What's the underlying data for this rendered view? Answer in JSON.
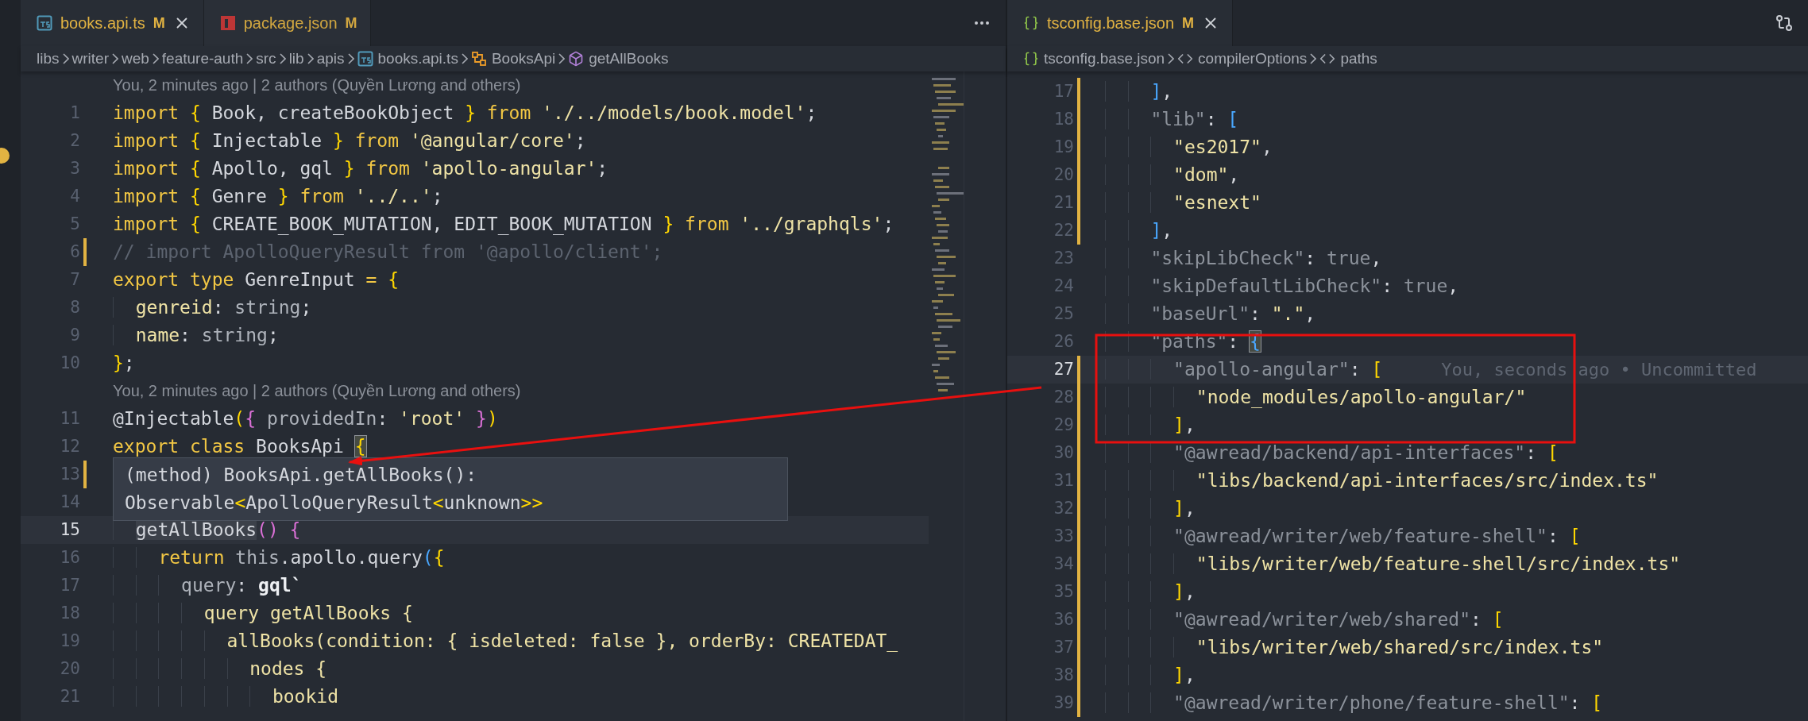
{
  "left_editor": {
    "tabs": [
      {
        "label": "books.api.ts",
        "status": "M",
        "kind": "ts",
        "selected": true
      },
      {
        "label": "package.json",
        "status": "M",
        "kind": "npm",
        "selected": false
      }
    ],
    "breadcrumbs": [
      {
        "kind": "folder",
        "text": "libs"
      },
      {
        "kind": "folder",
        "text": "writer"
      },
      {
        "kind": "folder",
        "text": "web"
      },
      {
        "kind": "folder",
        "text": "feature-auth"
      },
      {
        "kind": "folder",
        "text": "src"
      },
      {
        "kind": "folder",
        "text": "lib"
      },
      {
        "kind": "folder",
        "text": "apis"
      },
      {
        "kind": "ts",
        "text": "books.api.ts"
      },
      {
        "kind": "class",
        "text": "BooksApi"
      },
      {
        "kind": "method",
        "text": "getAllBooks"
      }
    ],
    "lines": [
      {
        "kind": "blame",
        "text": "You, 2 minutes ago | 2 authors (Quyền Lương and others)"
      },
      {
        "kind": "code",
        "number": "1",
        "modified": false,
        "current": false,
        "tokens": [
          {
            "kind": "kw",
            "text": "import"
          },
          {
            "kind": "b1",
            "text": " {"
          },
          {
            "kind": "id",
            "text": " Book, createBookObject "
          },
          {
            "kind": "b1",
            "text": "}"
          },
          {
            "kind": "kw",
            "text": " from"
          },
          {
            "kind": "str",
            "text": " './../models/book.model'"
          },
          {
            "kind": "id",
            "text": ";"
          }
        ]
      },
      {
        "kind": "code",
        "number": "2",
        "modified": false,
        "current": false,
        "tokens": [
          {
            "kind": "kw",
            "text": "import"
          },
          {
            "kind": "b1",
            "text": " {"
          },
          {
            "kind": "id",
            "text": " Injectable "
          },
          {
            "kind": "b1",
            "text": "}"
          },
          {
            "kind": "kw",
            "text": " from"
          },
          {
            "kind": "str",
            "text": " '@angular/core'"
          },
          {
            "kind": "id",
            "text": ";"
          }
        ]
      },
      {
        "kind": "code",
        "number": "3",
        "modified": false,
        "current": false,
        "tokens": [
          {
            "kind": "kw",
            "text": "import"
          },
          {
            "kind": "b1",
            "text": " {"
          },
          {
            "kind": "id",
            "text": " Apollo, gql "
          },
          {
            "kind": "b1",
            "text": "}"
          },
          {
            "kind": "kw",
            "text": " from"
          },
          {
            "kind": "str",
            "text": " 'apollo-angular'"
          },
          {
            "kind": "id",
            "text": ";"
          }
        ]
      },
      {
        "kind": "code",
        "number": "4",
        "modified": false,
        "current": false,
        "tokens": [
          {
            "kind": "kw",
            "text": "import"
          },
          {
            "kind": "b1",
            "text": " {"
          },
          {
            "kind": "id",
            "text": " Genre "
          },
          {
            "kind": "b1",
            "text": "}"
          },
          {
            "kind": "kw",
            "text": " from"
          },
          {
            "kind": "str",
            "text": " '../..'"
          },
          {
            "kind": "id",
            "text": ";"
          }
        ]
      },
      {
        "kind": "code",
        "number": "5",
        "modified": false,
        "current": false,
        "tokens": [
          {
            "kind": "kw",
            "text": "import"
          },
          {
            "kind": "b1",
            "text": " {"
          },
          {
            "kind": "id",
            "text": " CREATE_BOOK_MUTATION, EDIT_BOOK_MUTATION "
          },
          {
            "kind": "b1",
            "text": "}"
          },
          {
            "kind": "kw",
            "text": " from"
          },
          {
            "kind": "str",
            "text": " '../graphqls'"
          },
          {
            "kind": "id",
            "text": ";"
          }
        ]
      },
      {
        "kind": "code",
        "number": "6",
        "modified": true,
        "current": false,
        "tokens": [
          {
            "kind": "cmt",
            "text": "// import ApolloQueryResult from '@apollo/client';"
          }
        ]
      },
      {
        "kind": "code",
        "number": "7",
        "modified": false,
        "current": false,
        "tokens": [
          {
            "kind": "kw",
            "text": "export"
          },
          {
            "kind": "kw",
            "text": " type"
          },
          {
            "kind": "id",
            "text": " GenreInput "
          },
          {
            "kind": "kw",
            "text": "="
          },
          {
            "kind": "b1",
            "text": " {"
          }
        ]
      },
      {
        "kind": "code",
        "number": "8",
        "modified": false,
        "current": false,
        "tokens": [
          {
            "kind": "prop",
            "text": "  genreid"
          },
          {
            "kind": "id",
            "text": ": "
          },
          {
            "kind": "type",
            "text": "string"
          },
          {
            "kind": "id",
            "text": ";"
          }
        ]
      },
      {
        "kind": "code",
        "number": "9",
        "modified": false,
        "current": false,
        "tokens": [
          {
            "kind": "prop",
            "text": "  name"
          },
          {
            "kind": "id",
            "text": ": "
          },
          {
            "kind": "type",
            "text": "string"
          },
          {
            "kind": "id",
            "text": ";"
          }
        ]
      },
      {
        "kind": "code",
        "number": "10",
        "modified": false,
        "current": false,
        "tokens": [
          {
            "kind": "b1",
            "text": "}"
          },
          {
            "kind": "id",
            "text": ";"
          }
        ]
      },
      {
        "kind": "blame",
        "text": "You, 2 minutes ago | 2 authors (Quyền Lương and others)"
      },
      {
        "kind": "code",
        "number": "11",
        "modified": false,
        "current": false,
        "tokens": [
          {
            "kind": "dec",
            "text": "@Injectable"
          },
          {
            "kind": "b1",
            "text": "("
          },
          {
            "kind": "b2",
            "text": "{"
          },
          {
            "kind": "dprop",
            "text": " providedIn"
          },
          {
            "kind": "id",
            "text": ": "
          },
          {
            "kind": "str",
            "text": "'root'"
          },
          {
            "kind": "b2",
            "text": " }"
          },
          {
            "kind": "b1",
            "text": ")"
          }
        ]
      },
      {
        "kind": "code",
        "number": "12",
        "modified": false,
        "current": false,
        "tokens": [
          {
            "kind": "kw",
            "text": "export"
          },
          {
            "kind": "kw",
            "text": " class"
          },
          {
            "kind": "id",
            "text": " BooksApi "
          },
          {
            "kind": "b1m",
            "text": "{"
          }
        ]
      },
      {
        "kind": "code",
        "number": "13",
        "modified": true,
        "current": false
      },
      {
        "kind": "code",
        "number": "14",
        "modified": false,
        "current": false
      },
      {
        "kind": "code",
        "number": "15",
        "modified": false,
        "current": true,
        "tokens": [
          {
            "kind": "fnhl",
            "text": "  getAllBooks"
          },
          {
            "kind": "b2",
            "text": "()"
          },
          {
            "kind": "b2",
            "text": " {"
          }
        ]
      },
      {
        "kind": "code",
        "number": "16",
        "modified": false,
        "current": false,
        "tokens": [
          {
            "kind": "kw",
            "text": "    return"
          },
          {
            "kind": "dim",
            "text": " this"
          },
          {
            "kind": "id",
            "text": ".apollo.query"
          },
          {
            "kind": "b3",
            "text": "("
          },
          {
            "kind": "b1",
            "text": "{"
          }
        ]
      },
      {
        "kind": "code",
        "number": "17",
        "modified": false,
        "current": false,
        "tokens": [
          {
            "kind": "dprop",
            "text": "      query"
          },
          {
            "kind": "id",
            "text": ": "
          },
          {
            "kind": "gql",
            "text": "gql`"
          }
        ]
      },
      {
        "kind": "code",
        "number": "18",
        "modified": false,
        "current": false,
        "tokens": [
          {
            "kind": "str",
            "text": "        query getAllBooks {"
          }
        ]
      },
      {
        "kind": "code",
        "number": "19",
        "modified": false,
        "current": false,
        "tokens": [
          {
            "kind": "str",
            "text": "          allBooks(condition: { isdeleted: false }, orderBy: CREATEDAT_"
          }
        ]
      },
      {
        "kind": "code",
        "number": "20",
        "modified": false,
        "current": false,
        "tokens": [
          {
            "kind": "str",
            "text": "            nodes {"
          }
        ]
      },
      {
        "kind": "code",
        "number": "21",
        "modified": false,
        "current": false,
        "tokens": [
          {
            "kind": "str",
            "text": "              bookid"
          }
        ]
      }
    ],
    "hover": {
      "lines": [
        [
          {
            "kind": "id",
            "text": "(method) BooksApi.getAllBooks():"
          }
        ],
        [
          {
            "kind": "id",
            "text": "Observable"
          },
          {
            "kind": "b1",
            "text": "<"
          },
          {
            "kind": "id",
            "text": "ApolloQueryResult"
          },
          {
            "kind": "b1",
            "text": "<"
          },
          {
            "kind": "id",
            "text": "unknown"
          },
          {
            "kind": "b1",
            "text": ">>"
          }
        ]
      ]
    }
  },
  "right_editor": {
    "tabs": [
      {
        "label": "tsconfig.base.json",
        "status": "M",
        "kind": "config",
        "selected": true
      }
    ],
    "breadcrumbs": [
      {
        "kind": "config",
        "text": "tsconfig.base.json"
      },
      {
        "kind": "key",
        "text": "compilerOptions"
      },
      {
        "kind": "key",
        "text": "paths"
      }
    ],
    "lines": [
      {
        "kind": "code",
        "number": "17",
        "modified": true,
        "current": false,
        "tokens": [
          {
            "kind": "b3",
            "text": "    ]"
          },
          {
            "kind": "id",
            "text": ","
          }
        ]
      },
      {
        "kind": "code",
        "number": "18",
        "modified": true,
        "current": false,
        "tokens": [
          {
            "kind": "key",
            "text": "    \"lib\""
          },
          {
            "kind": "id",
            "text": ": "
          },
          {
            "kind": "b3",
            "text": "["
          }
        ]
      },
      {
        "kind": "code",
        "number": "19",
        "modified": true,
        "current": false,
        "tokens": [
          {
            "kind": "jstr",
            "text": "      \"es2017\""
          },
          {
            "kind": "id",
            "text": ","
          }
        ]
      },
      {
        "kind": "code",
        "number": "20",
        "modified": true,
        "current": false,
        "tokens": [
          {
            "kind": "jstr",
            "text": "      \"dom\""
          },
          {
            "kind": "id",
            "text": ","
          }
        ]
      },
      {
        "kind": "code",
        "number": "21",
        "modified": true,
        "current": false,
        "tokens": [
          {
            "kind": "jstr",
            "text": "      \"esnext\""
          }
        ]
      },
      {
        "kind": "code",
        "number": "22",
        "modified": true,
        "current": false,
        "tokens": [
          {
            "kind": "b3",
            "text": "    ]"
          },
          {
            "kind": "id",
            "text": ","
          }
        ]
      },
      {
        "kind": "code",
        "number": "23",
        "modified": false,
        "current": false,
        "tokens": [
          {
            "kind": "key",
            "text": "    \"skipLibCheck\""
          },
          {
            "kind": "id",
            "text": ": "
          },
          {
            "kind": "bool",
            "text": "true"
          },
          {
            "kind": "id",
            "text": ","
          }
        ]
      },
      {
        "kind": "code",
        "number": "24",
        "modified": false,
        "current": false,
        "tokens": [
          {
            "kind": "key",
            "text": "    \"skipDefaultLibCheck\""
          },
          {
            "kind": "id",
            "text": ": "
          },
          {
            "kind": "bool",
            "text": "true"
          },
          {
            "kind": "id",
            "text": ","
          }
        ]
      },
      {
        "kind": "code",
        "number": "25",
        "modified": false,
        "current": false,
        "tokens": [
          {
            "kind": "key",
            "text": "    \"baseUrl\""
          },
          {
            "kind": "id",
            "text": ": "
          },
          {
            "kind": "jstr",
            "text": "\".\""
          },
          {
            "kind": "id",
            "text": ","
          }
        ]
      },
      {
        "kind": "code",
        "number": "26",
        "modified": false,
        "current": false,
        "tokens": [
          {
            "kind": "key",
            "text": "    \"paths\""
          },
          {
            "kind": "id",
            "text": ": "
          },
          {
            "kind": "b3m",
            "text": "{"
          }
        ]
      },
      {
        "kind": "code",
        "number": "27",
        "modified": true,
        "current": true,
        "blame": "You, seconds ago • Uncommitted",
        "tokens": [
          {
            "kind": "key",
            "text": "      \"apollo-angular\""
          },
          {
            "kind": "id",
            "text": ": "
          },
          {
            "kind": "b1",
            "text": "["
          }
        ]
      },
      {
        "kind": "code",
        "number": "28",
        "modified": true,
        "current": false,
        "tokens": [
          {
            "kind": "jstr",
            "text": "        \"node_modules/apollo-angular/\""
          }
        ]
      },
      {
        "kind": "code",
        "number": "29",
        "modified": true,
        "current": false,
        "tokens": [
          {
            "kind": "b1",
            "text": "      ]"
          },
          {
            "kind": "id",
            "text": ","
          }
        ]
      },
      {
        "kind": "code",
        "number": "30",
        "modified": true,
        "current": false,
        "tokens": [
          {
            "kind": "key",
            "text": "      \"@awread/backend/api-interfaces\""
          },
          {
            "kind": "id",
            "text": ": "
          },
          {
            "kind": "b1",
            "text": "["
          }
        ]
      },
      {
        "kind": "code",
        "number": "31",
        "modified": true,
        "current": false,
        "tokens": [
          {
            "kind": "jstr",
            "text": "        \"libs/backend/api-interfaces/src/index.ts\""
          }
        ]
      },
      {
        "kind": "code",
        "number": "32",
        "modified": true,
        "current": false,
        "tokens": [
          {
            "kind": "b1",
            "text": "      ]"
          },
          {
            "kind": "id",
            "text": ","
          }
        ]
      },
      {
        "kind": "code",
        "number": "33",
        "modified": true,
        "current": false,
        "tokens": [
          {
            "kind": "key",
            "text": "      \"@awread/writer/web/feature-shell\""
          },
          {
            "kind": "id",
            "text": ": "
          },
          {
            "kind": "b1",
            "text": "["
          }
        ]
      },
      {
        "kind": "code",
        "number": "34",
        "modified": true,
        "current": false,
        "tokens": [
          {
            "kind": "jstr",
            "text": "        \"libs/writer/web/feature-shell/src/index.ts\""
          }
        ]
      },
      {
        "kind": "code",
        "number": "35",
        "modified": true,
        "current": false,
        "tokens": [
          {
            "kind": "b1",
            "text": "      ]"
          },
          {
            "kind": "id",
            "text": ","
          }
        ]
      },
      {
        "kind": "code",
        "number": "36",
        "modified": true,
        "current": false,
        "tokens": [
          {
            "kind": "key",
            "text": "      \"@awread/writer/web/shared\""
          },
          {
            "kind": "id",
            "text": ": "
          },
          {
            "kind": "b1",
            "text": "["
          }
        ]
      },
      {
        "kind": "code",
        "number": "37",
        "modified": true,
        "current": false,
        "tokens": [
          {
            "kind": "jstr",
            "text": "        \"libs/writer/web/shared/src/index.ts\""
          }
        ]
      },
      {
        "kind": "code",
        "number": "38",
        "modified": true,
        "current": false,
        "tokens": [
          {
            "kind": "b1",
            "text": "      ]"
          },
          {
            "kind": "id",
            "text": ","
          }
        ]
      },
      {
        "kind": "code",
        "number": "39",
        "modified": true,
        "current": false,
        "tokens": [
          {
            "kind": "key",
            "text": "      \"@awread/writer/phone/feature-shell\""
          },
          {
            "kind": "id",
            "text": ": "
          },
          {
            "kind": "b1",
            "text": "["
          }
        ]
      }
    ]
  }
}
